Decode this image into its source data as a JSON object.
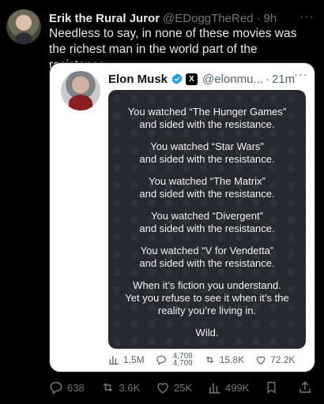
{
  "outer": {
    "display_name": "Erik the Rural Juror",
    "handle": "@EDoggTheRed",
    "separator": "·",
    "time": "9h",
    "more": "···",
    "text": "Needless to say, in none of these movies was the richest man in the world part of the resistance.",
    "actions": {
      "replies": "638",
      "reposts": "3.6K",
      "likes": "25K",
      "views": "499K"
    }
  },
  "quote": {
    "display_name": "Elon Musk",
    "handle": "@elonmu...",
    "separator": "·",
    "time": "21m",
    "more": "···",
    "x_badge": "X",
    "image_text": {
      "blocks": [
        [
          "You watched “The Hunger Games”",
          "and sided with the resistance."
        ],
        [
          "You watched “Star Wars”",
          "and sided with the resistance."
        ],
        [
          "You watched “The Matrix”",
          "and sided with the resistance."
        ],
        [
          "You watched “Divergent”",
          "and sided with the resistance."
        ],
        [
          "You watched “V for Vendetta”",
          "and sided with the resistance."
        ],
        [
          "When it’s fiction you understand.",
          "Yet you refuse to see it when it’s the",
          "reality you’re living in."
        ]
      ],
      "closing": "Wild."
    },
    "actions": {
      "views": "1.5M",
      "replies_top": "4,709",
      "replies_bottom": "4,709",
      "reposts": "15.8K",
      "likes": "72.2K"
    }
  },
  "colors": {
    "background": "#000000",
    "text_primary": "#e7e9ea",
    "text_secondary": "#71767b",
    "verified_blue": "#1d9bf0",
    "card_bg": "#ffffff",
    "image_bg": "#262a30"
  },
  "icons": [
    "more-icon",
    "verified-icon",
    "x-badge-icon",
    "views-icon",
    "reply-icon",
    "repost-icon",
    "like-icon",
    "bookmark-icon",
    "share-icon"
  ]
}
